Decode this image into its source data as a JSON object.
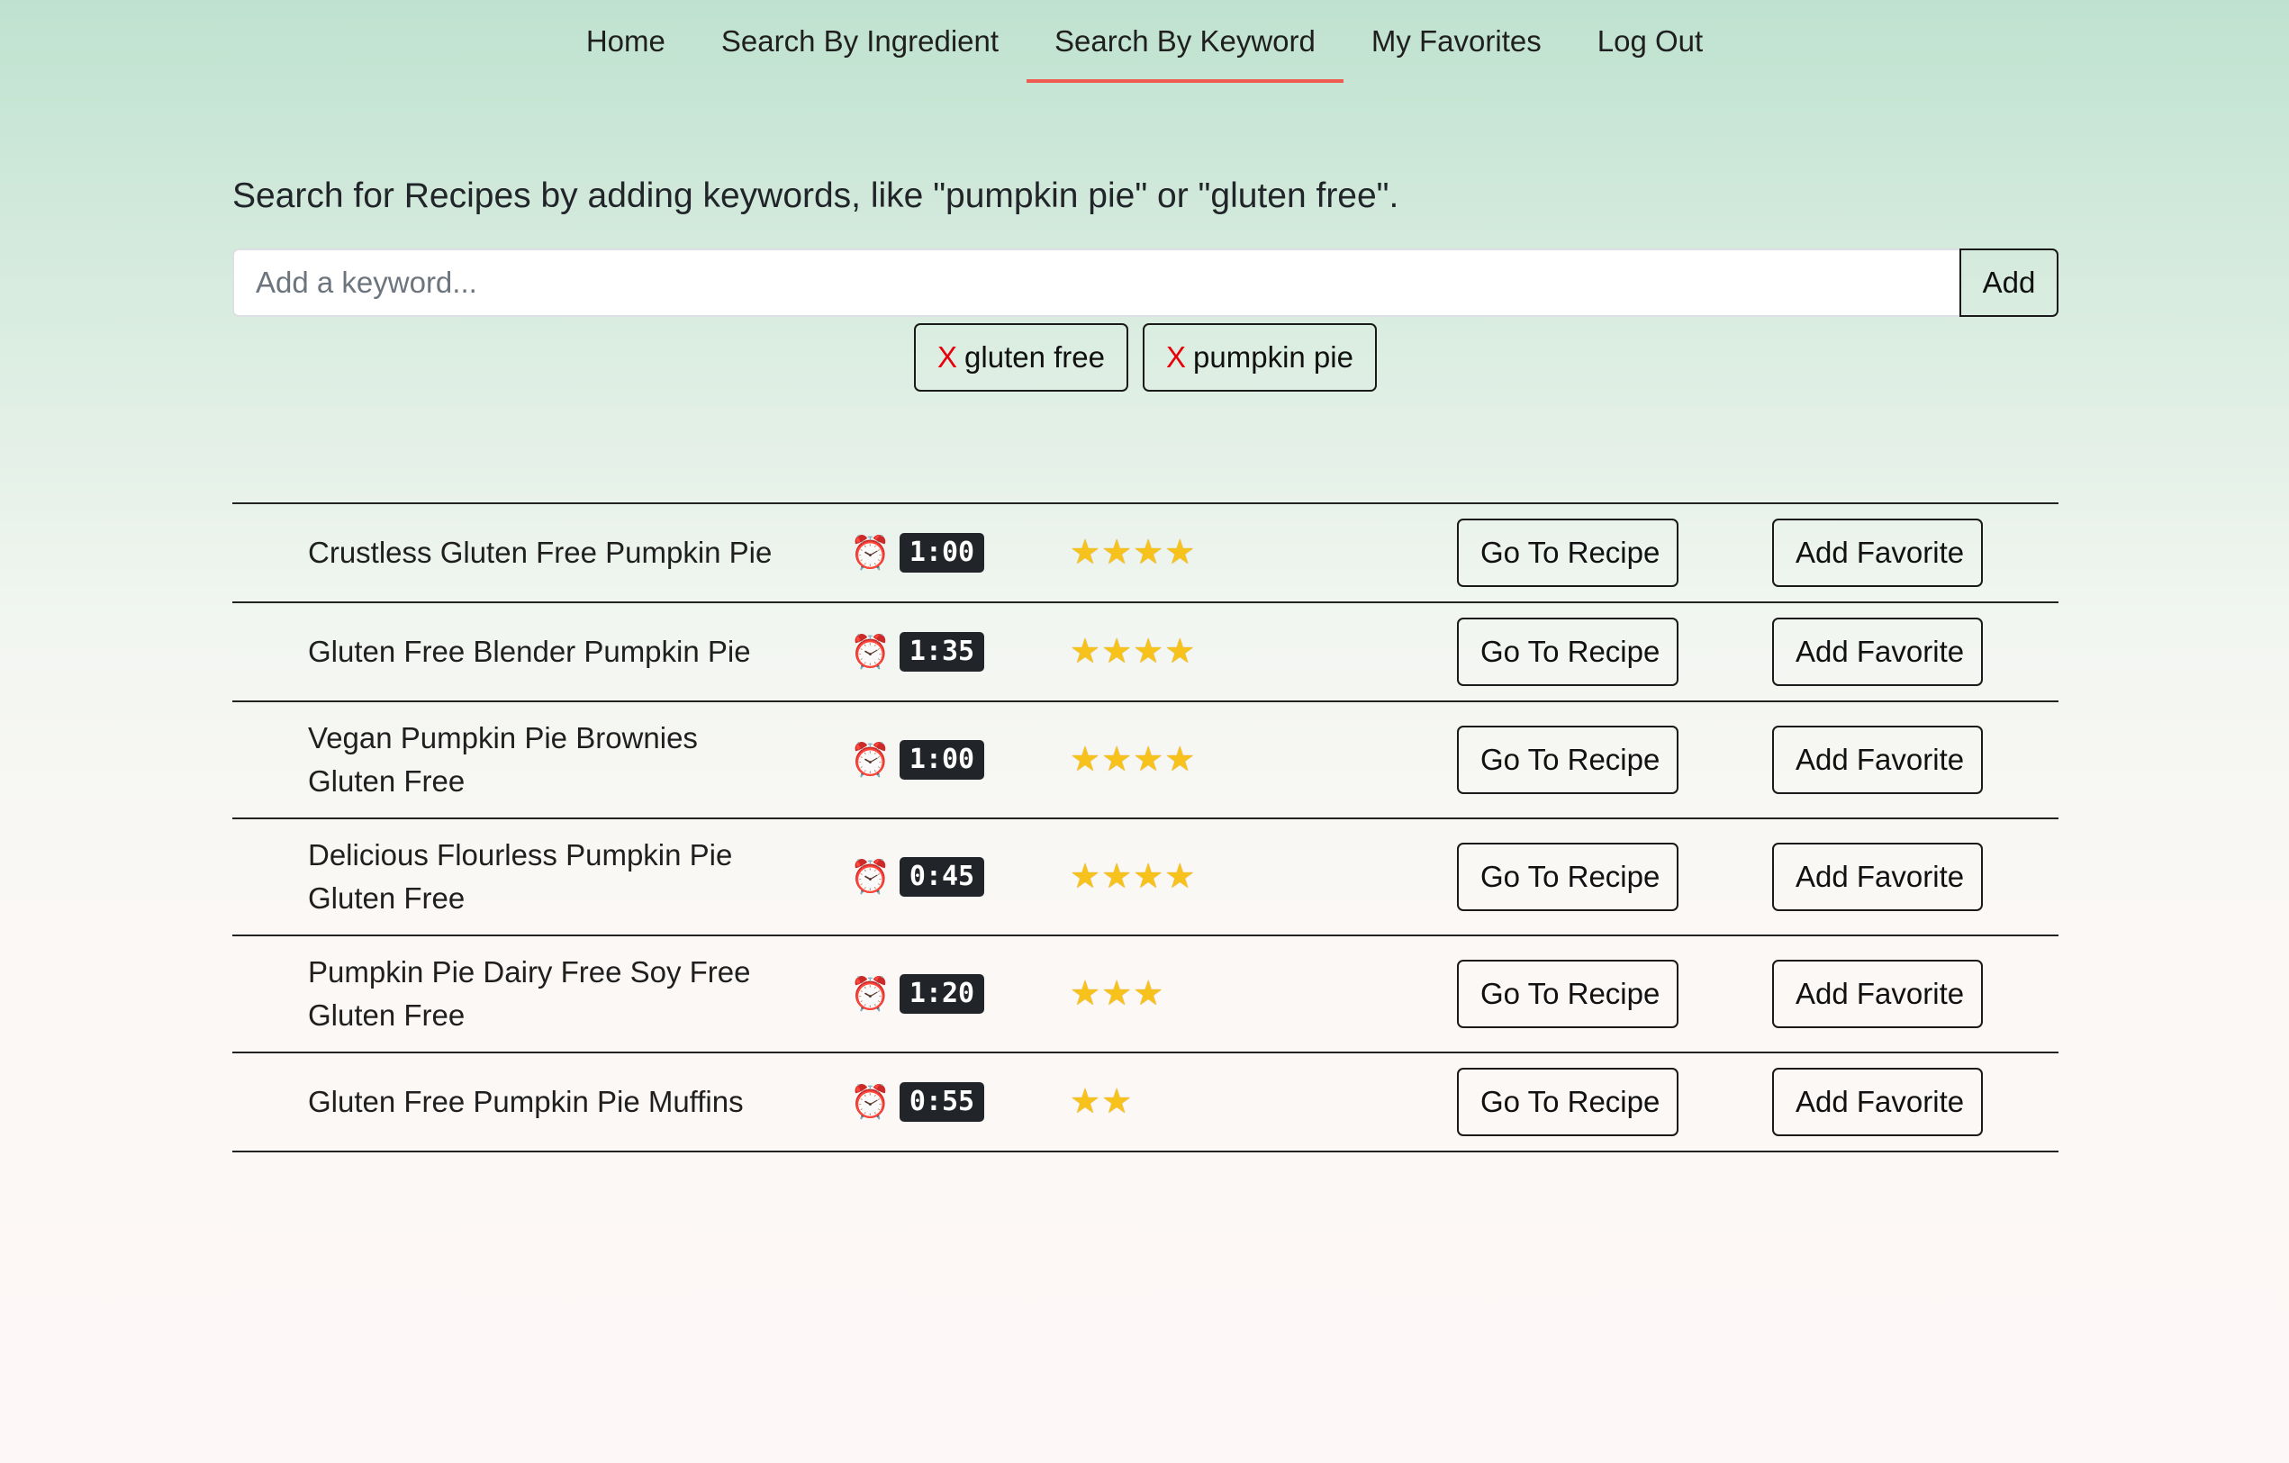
{
  "nav": {
    "items": [
      {
        "label": "Home"
      },
      {
        "label": "Search By Ingredient"
      },
      {
        "label": "Search By Keyword",
        "active": true
      },
      {
        "label": "My Favorites"
      },
      {
        "label": "Log Out"
      }
    ]
  },
  "search": {
    "prompt": "Search for Recipes by adding keywords, like \"pumpkin pie\" or \"gluten free\".",
    "placeholder": "Add a keyword...",
    "value": "",
    "add_label": "Add"
  },
  "tags": [
    {
      "x_label": "X",
      "label": "gluten free"
    },
    {
      "x_label": "X",
      "label": "pumpkin pie"
    }
  ],
  "colors": {
    "accent_underline": "#ef5b50",
    "tag_x": "#e8000b",
    "time_badge_bg": "#212529"
  },
  "icons": {
    "clock": "alarm-clock-icon",
    "star": "star-icon"
  },
  "results": [
    {
      "name": "Crustless Gluten Free Pumpkin Pie",
      "time": "1:00",
      "stars": 4,
      "goto_label": "Go To Recipe",
      "fav_label": "Add Favorite"
    },
    {
      "name": "Gluten Free Blender Pumpkin Pie",
      "time": "1:35",
      "stars": 4,
      "goto_label": "Go To Recipe",
      "fav_label": "Add Favorite"
    },
    {
      "name": "Vegan Pumpkin Pie Brownies Gluten Free",
      "time": "1:00",
      "stars": 4,
      "goto_label": "Go To Recipe",
      "fav_label": "Add Favorite"
    },
    {
      "name": "Delicious Flourless Pumpkin Pie Gluten Free",
      "time": "0:45",
      "stars": 4,
      "goto_label": "Go To Recipe",
      "fav_label": "Add Favorite"
    },
    {
      "name": "Pumpkin Pie Dairy Free Soy Free Gluten Free",
      "time": "1:20",
      "stars": 3,
      "goto_label": "Go To Recipe",
      "fav_label": "Add Favorite"
    },
    {
      "name": "Gluten Free Pumpkin Pie Muffins",
      "time": "0:55",
      "stars": 2,
      "goto_label": "Go To Recipe",
      "fav_label": "Add Favorite"
    }
  ]
}
